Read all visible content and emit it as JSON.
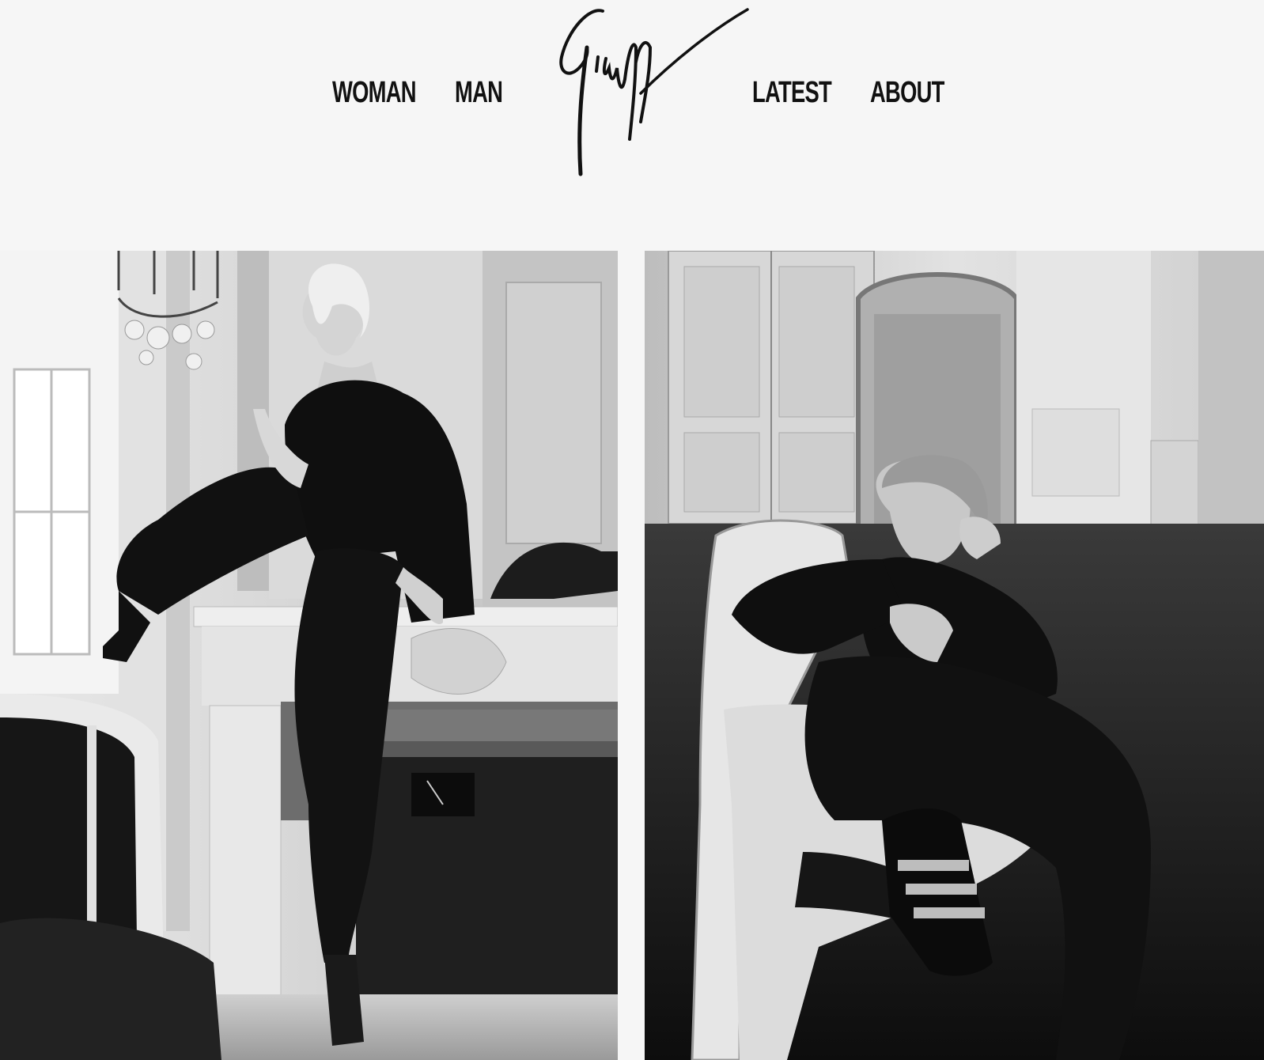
{
  "header": {
    "nav_left": [
      {
        "label": "WOMAN"
      },
      {
        "label": "MAN"
      }
    ],
    "nav_right": [
      {
        "label": "LATEST"
      },
      {
        "label": "ABOUT"
      }
    ],
    "logo_icon": "giuseppe-signature-logo"
  },
  "gallery": {
    "panels": [
      {
        "icon": "woman-campaign-photo"
      },
      {
        "icon": "man-campaign-photo"
      }
    ]
  },
  "colors": {
    "background": "#f6f6f6",
    "text": "#111111"
  }
}
